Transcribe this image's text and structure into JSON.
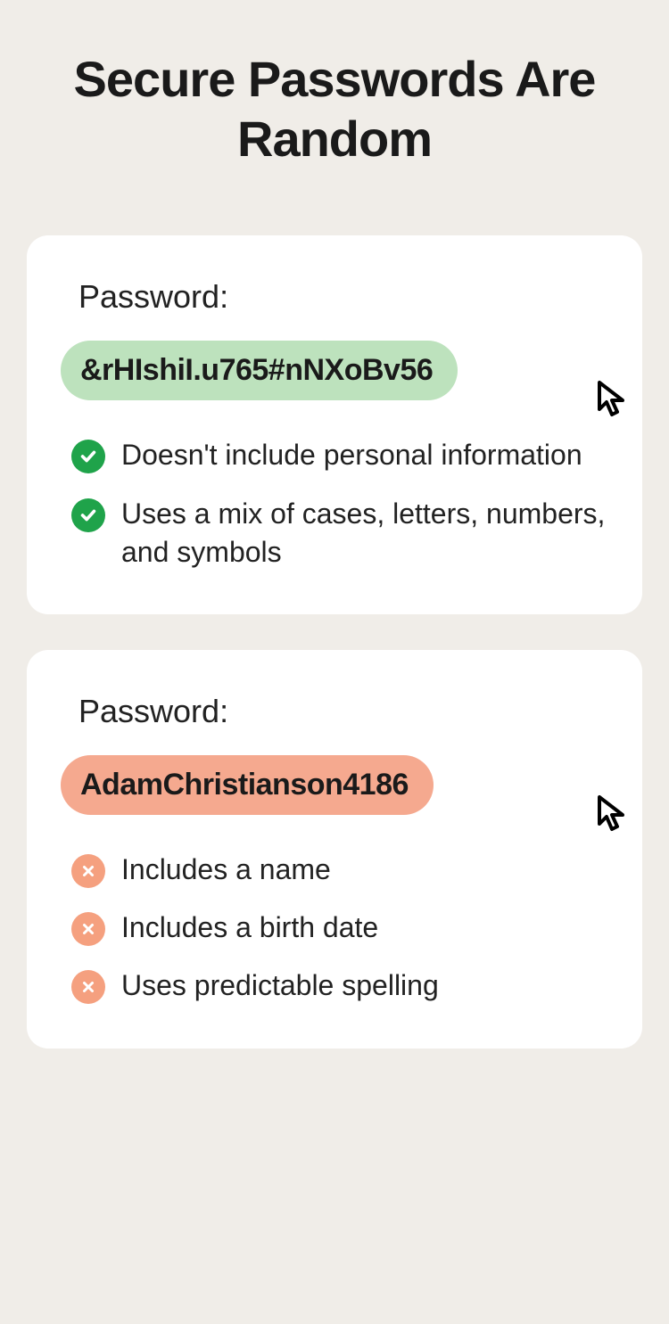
{
  "title": "Secure Passwords Are Random",
  "good": {
    "label": "Password:",
    "password": "&rHIshiI.u765#nNXoBv56",
    "features": [
      "Doesn't include personal information",
      "Uses a mix of cases, letters, numbers, and symbols"
    ]
  },
  "bad": {
    "label": "Password:",
    "password": "AdamChristianson4186",
    "features": [
      "Includes a name",
      "Includes a birth date",
      "Uses predictable spelling"
    ]
  }
}
